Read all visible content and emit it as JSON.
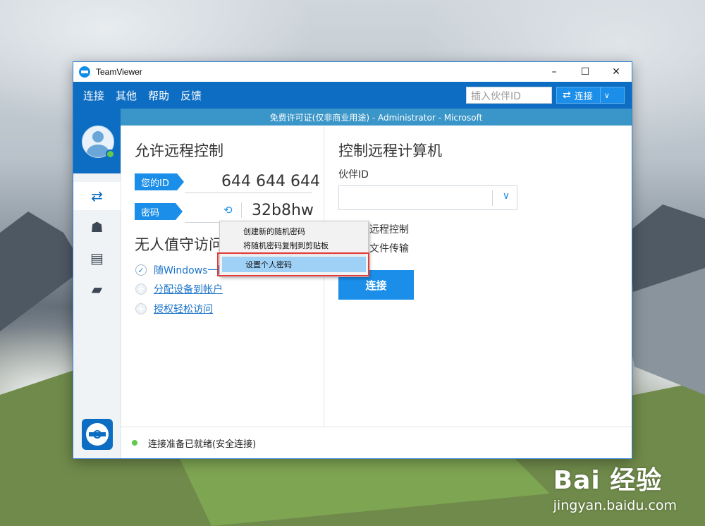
{
  "window": {
    "title": "TeamViewer",
    "minimize": "–",
    "maximize": "☐",
    "close": "✕"
  },
  "menubar": {
    "items": [
      "连接",
      "其他",
      "帮助",
      "反馈"
    ],
    "partner_placeholder": "插入伙伴ID",
    "connect_label": "连接"
  },
  "license_bar": "免费许可证(仅非商业用途) - Administrator - Microsoft",
  "allow_remote": {
    "title": "允许远程控制",
    "id_label": "您的ID",
    "id_value": "644 644 644",
    "password_label": "密码",
    "password_value": "32b8hw"
  },
  "unattended": {
    "title": "无人值守访问",
    "items": [
      {
        "label": "随Windows一同启动TeamViewer",
        "checked": true
      },
      {
        "label": "分配设备到帐户",
        "checked": false
      },
      {
        "label": "授权轻松访问",
        "checked": false
      }
    ]
  },
  "control_remote": {
    "title": "控制远程计算机",
    "partner_label": "伙伴ID",
    "options": [
      "远程控制",
      "文件传输"
    ],
    "connect_button": "连接"
  },
  "context_menu": {
    "items": [
      "创建新的随机密码",
      "将随机密码复制到剪贴板",
      "设置个人密码"
    ],
    "highlighted_index": 2
  },
  "status": {
    "text": "连接准备已就绪(安全连接)",
    "color": "#62c94b"
  },
  "watermark": {
    "logo": "Bai 经验",
    "url": "jingyan.baidu.com"
  },
  "colors": {
    "accent": "#1a8ee8",
    "header": "#0d6dc2",
    "highlight_box": "#e23b3b"
  }
}
